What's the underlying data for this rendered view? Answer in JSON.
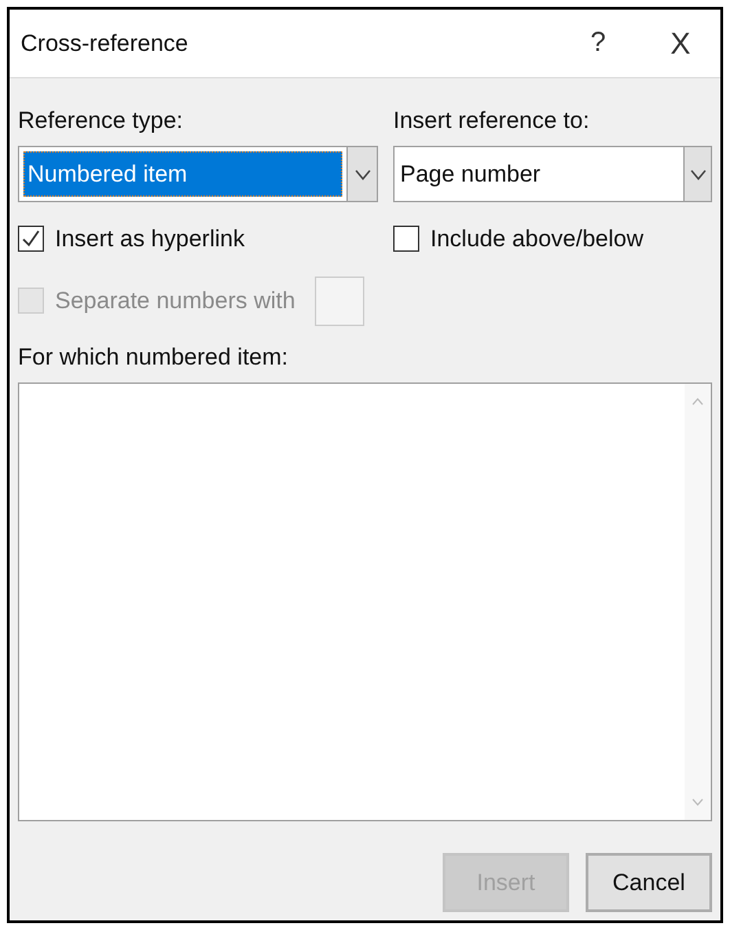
{
  "window": {
    "title": "Cross-reference",
    "help": "?",
    "close": "X"
  },
  "reference_type": {
    "label": "Reference type:",
    "value": "Numbered item",
    "selected": true
  },
  "insert_reference_to": {
    "label": "Insert reference to:",
    "value": "Page number"
  },
  "checkboxes": [
    {
      "label": "Insert as hyperlink",
      "checked": true,
      "disabled": false
    },
    {
      "label": "Include above/below",
      "checked": false,
      "disabled": false
    }
  ],
  "separate_numbers": {
    "label": "Separate numbers with",
    "checked": false,
    "disabled": true
  },
  "list": {
    "label": "For which numbered item:"
  },
  "buttons": [
    {
      "label": "Insert",
      "disabled": true
    },
    {
      "label": "Cancel",
      "disabled": false
    }
  ]
}
